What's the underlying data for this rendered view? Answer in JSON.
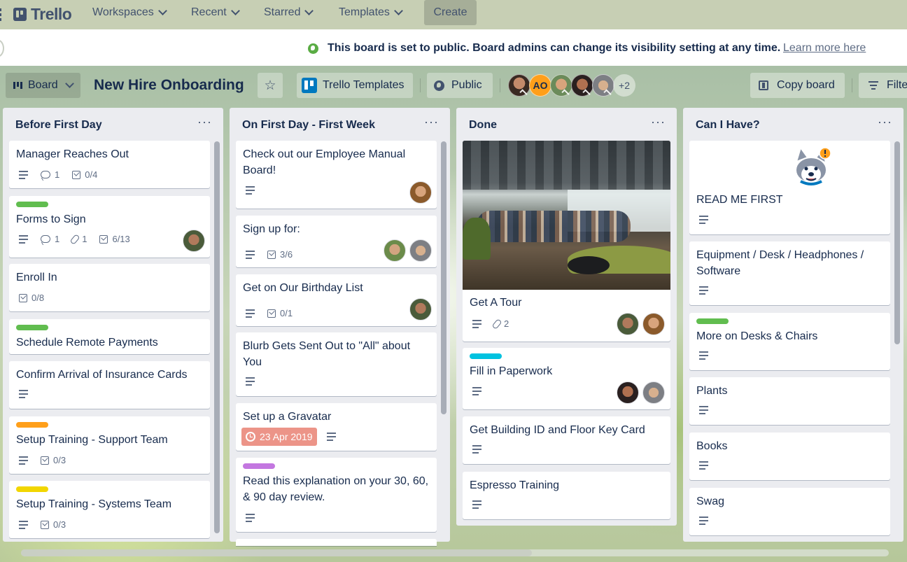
{
  "topnav": {
    "logo": "Trello",
    "workspaces": "Workspaces",
    "recent": "Recent",
    "starred": "Starred",
    "templates": "Templates",
    "create": "Create"
  },
  "banner": {
    "message": "This board is set to public. Board admins can change its visibility setting at any time.",
    "link": "Learn more here"
  },
  "board_header": {
    "view": "Board",
    "title": "New Hire Onboarding",
    "templates_btn": "Trello Templates",
    "visibility": "Public",
    "member_initials": "AO",
    "more_members": "+2",
    "copy_board": "Copy board",
    "filter": "Filter"
  },
  "lists": [
    {
      "title": "Before First Day",
      "cards": [
        {
          "title": "Manager Reaches Out",
          "comments": "1",
          "checklist": "0/4"
        },
        {
          "title": "Forms to Sign",
          "comments": "1",
          "attachments": "1",
          "checklist": "6/13",
          "label": "#61bd4f"
        },
        {
          "title": "Enroll In",
          "checklist": "0/8"
        },
        {
          "title": "Schedule Remote Payments",
          "label": "#61bd4f"
        },
        {
          "title": "Confirm Arrival of Insurance Cards"
        },
        {
          "title": "Setup Training - Support Team",
          "checklist": "0/3",
          "label": "#ff9f1a"
        },
        {
          "title": "Setup Training - Systems Team",
          "checklist": "0/3",
          "label": "#f2d600"
        }
      ]
    },
    {
      "title": "On First Day - First Week",
      "cards": [
        {
          "title": "Check out our Employee Manual Board!"
        },
        {
          "title": "Sign up for:",
          "checklist": "3/6"
        },
        {
          "title": "Get on Our Birthday List",
          "checklist": "0/1"
        },
        {
          "title": "Blurb Gets Sent Out to \"All\" about You"
        },
        {
          "title": "Set up a Gravatar",
          "due": "23 Apr 2019"
        },
        {
          "title": "Read this explanation on your 30, 60, & 90 day review.",
          "label": "#c377e0"
        }
      ]
    },
    {
      "title": "Done",
      "cards": [
        {
          "title": "Get A Tour",
          "attachments": "2"
        },
        {
          "title": "Fill in Paperwork",
          "label": "#00c2e0"
        },
        {
          "title": "Get Building ID and Floor Key Card"
        },
        {
          "title": "Espresso Training"
        }
      ]
    },
    {
      "title": "Can I Have?",
      "cards": [
        {
          "title": "READ ME FIRST"
        },
        {
          "title": "Equipment / Desk / Headphones / Software"
        },
        {
          "title": "More on Desks & Chairs",
          "label": "#61bd4f"
        },
        {
          "title": "Plants"
        },
        {
          "title": "Books"
        },
        {
          "title": "Swag"
        }
      ]
    }
  ],
  "list_menu": "···",
  "colors": {
    "green": "#61bd4f",
    "orange": "#ff9f1a",
    "yellow": "#f2d600",
    "purple": "#c377e0",
    "sky": "#00c2e0",
    "due_red": "#ec9488",
    "list_bg": "#ebecf0"
  }
}
